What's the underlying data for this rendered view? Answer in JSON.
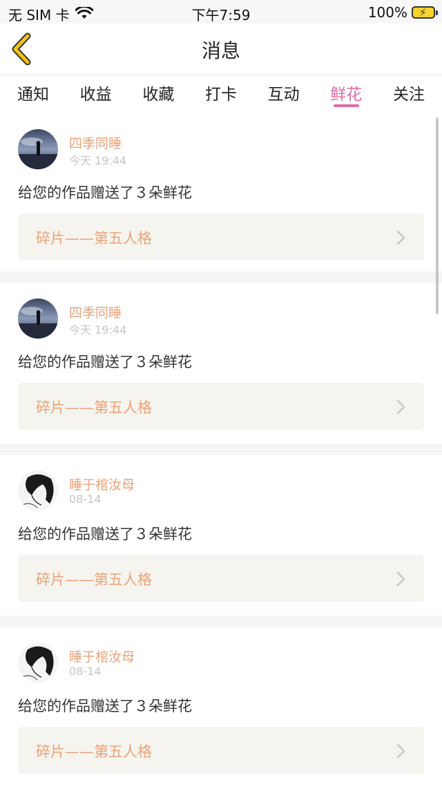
{
  "status_bar": {
    "carrier": "无 SIM 卡",
    "time": "下午7:59",
    "battery": "100%"
  },
  "nav": {
    "title": "消息",
    "back_icon": "chevron-left-icon"
  },
  "tabs": [
    {
      "label": "通知",
      "active": false
    },
    {
      "label": "收益",
      "active": false
    },
    {
      "label": "收藏",
      "active": false
    },
    {
      "label": "打卡",
      "active": false
    },
    {
      "label": "互动",
      "active": false
    },
    {
      "label": "鲜花",
      "active": true
    },
    {
      "label": "关注",
      "active": false
    }
  ],
  "notifications": [
    {
      "user": "四季同睡",
      "time": "今天 19:44",
      "message": "给您的作品赠送了３朵鲜花",
      "work": "碎片——第五人格"
    },
    {
      "user": "四季同睡",
      "time": "今天 19:44",
      "message": "给您的作品赠送了３朵鲜花",
      "work": "碎片——第五人格"
    },
    {
      "user": "睡于棺汝母",
      "time": "08-14",
      "message": "给您的作品赠送了３朵鲜花",
      "work": "碎片——第五人格"
    },
    {
      "user": "睡于棺汝母",
      "time": "08-14",
      "message": "给您的作品赠送了３朵鲜花",
      "work": "碎片——第五人格"
    }
  ],
  "colors": {
    "accent": "#e06aa6",
    "username": "#e8a37c",
    "back_arrow": "#f2c318"
  }
}
